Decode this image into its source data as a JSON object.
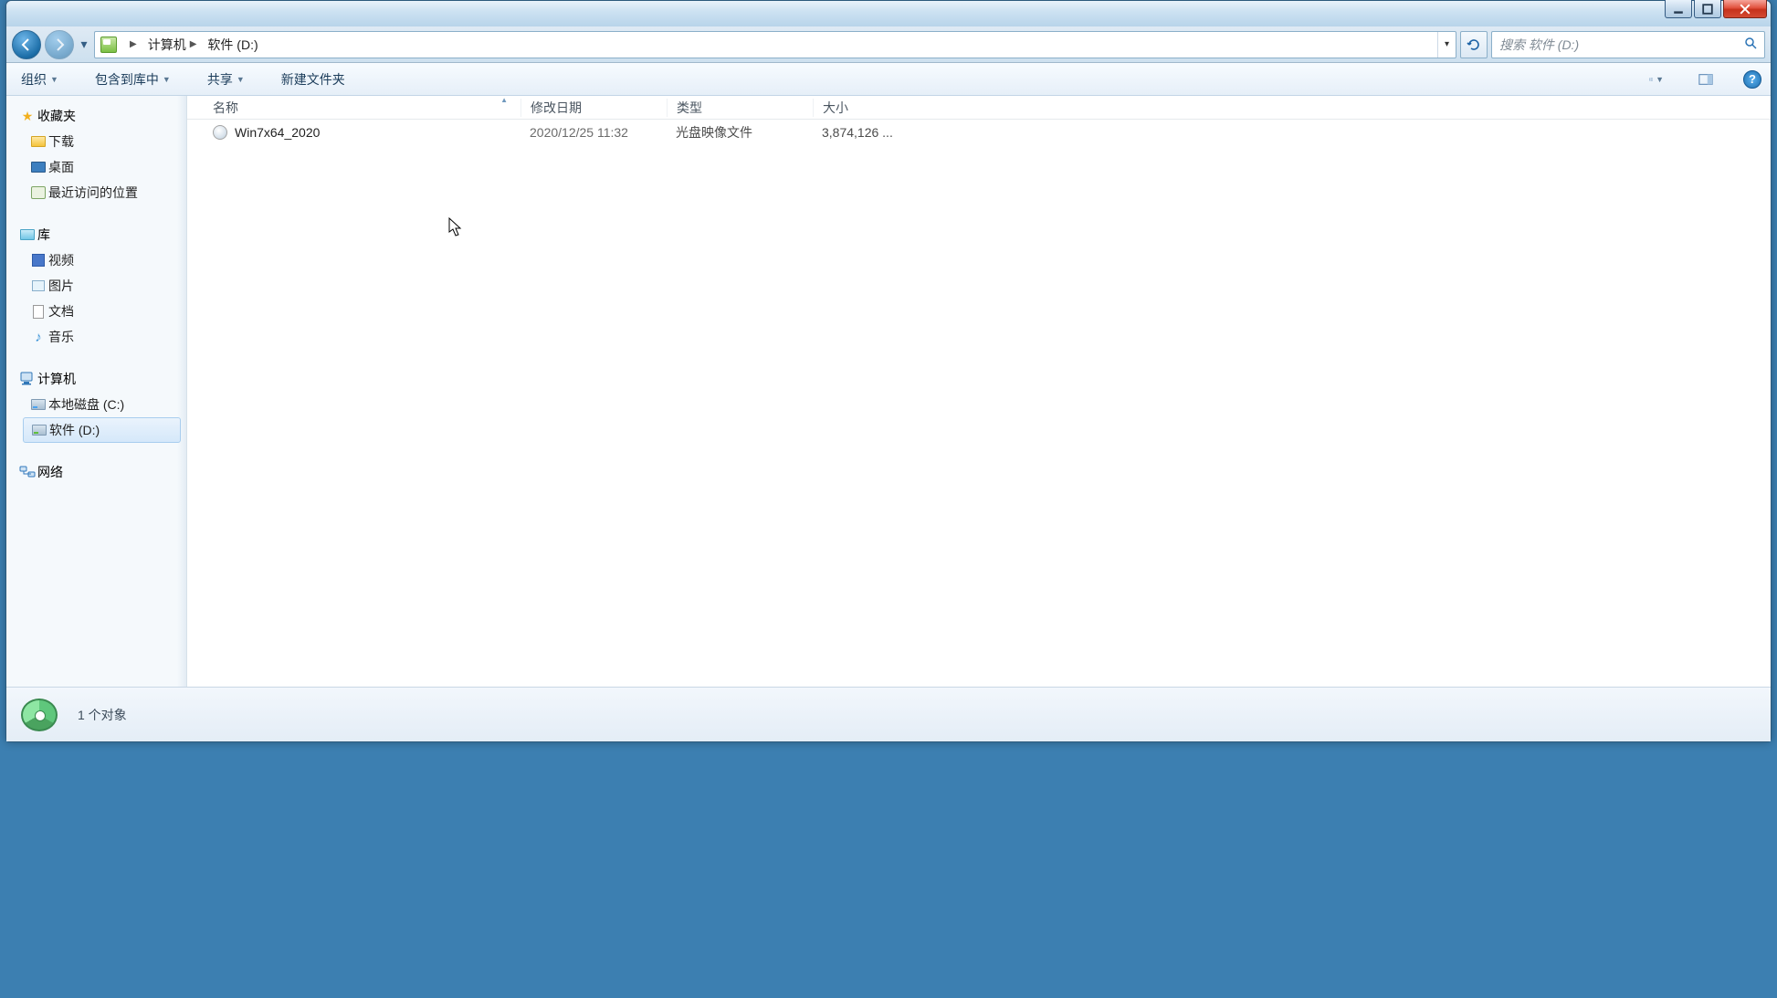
{
  "address": {
    "segments": [
      "计算机",
      "软件 (D:)"
    ]
  },
  "search": {
    "placeholder": "搜索 软件 (D:)"
  },
  "toolbar": {
    "organize": "组织",
    "include": "包含到库中",
    "share": "共享",
    "newfolder": "新建文件夹"
  },
  "columns": {
    "name": "名称",
    "date": "修改日期",
    "type": "类型",
    "size": "大小"
  },
  "sidebar": {
    "favorites": {
      "label": "收藏夹",
      "items": [
        "下载",
        "桌面",
        "最近访问的位置"
      ]
    },
    "libraries": {
      "label": "库",
      "items": [
        "视频",
        "图片",
        "文档",
        "音乐"
      ]
    },
    "computer": {
      "label": "计算机",
      "items": [
        "本地磁盘 (C:)",
        "软件 (D:)"
      ]
    },
    "network": {
      "label": "网络"
    }
  },
  "files": [
    {
      "name": "Win7x64_2020",
      "date": "2020/12/25 11:32",
      "type": "光盘映像文件",
      "size": "3,874,126 ..."
    }
  ],
  "status": {
    "text": "1 个对象"
  }
}
